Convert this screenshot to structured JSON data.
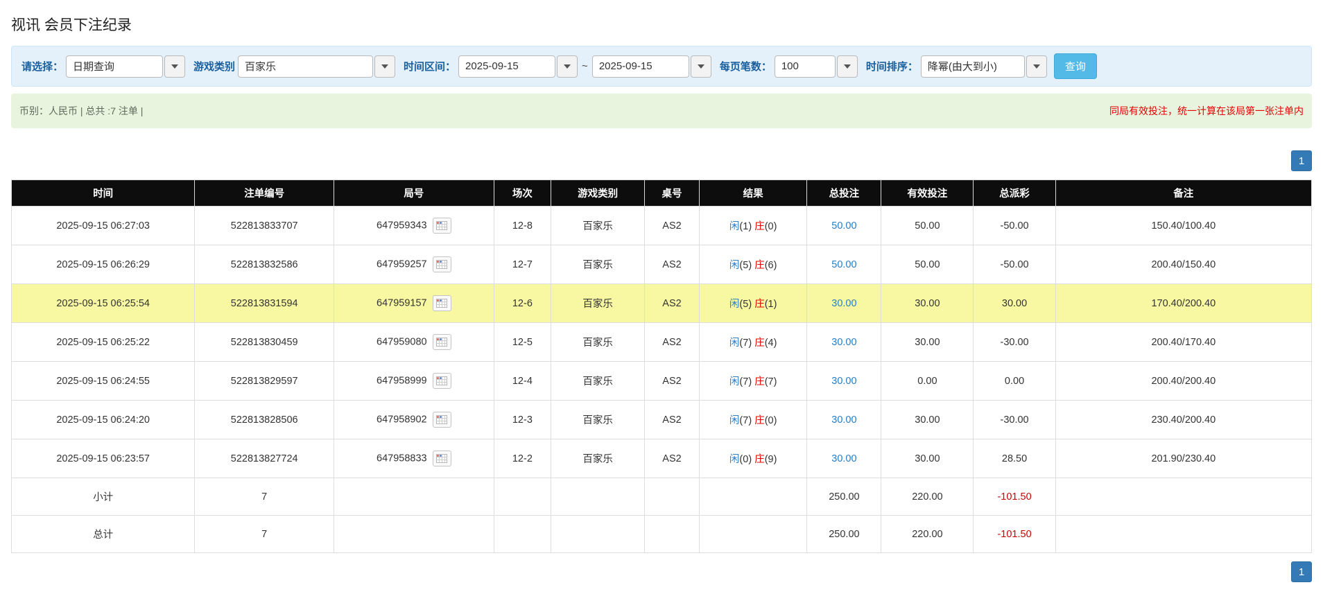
{
  "page": {
    "title": "视讯 会员下注纪录"
  },
  "filters": {
    "select_label": "请选择：",
    "select_value": "日期查询",
    "game_type_label": "游戏类别",
    "game_type_value": "百家乐",
    "date_range_label": "时间区间：",
    "date_from": "2025-09-15",
    "date_separator": "~",
    "date_to": "2025-09-15",
    "page_size_label": "每页笔数：",
    "page_size_value": "100",
    "sort_label": "时间排序：",
    "sort_value": "降幂(由大到小)",
    "search_button": "查询"
  },
  "summary": {
    "currency_info": "币别：人民币 | 总共 :7 注单 |",
    "notice": "同局有效投注，统一计算在该局第一张注单内"
  },
  "pagination": {
    "page": "1"
  },
  "table": {
    "headers": [
      "时间",
      "注单编号",
      "局号",
      "场次",
      "游戏类别",
      "桌号",
      "结果",
      "总投注",
      "有效投注",
      "总派彩",
      "备注"
    ],
    "rows": [
      {
        "time": "2025-09-15 06:27:03",
        "bet_id": "522813833707",
        "round_id": "647959343",
        "session": "12-8",
        "game": "百家乐",
        "table_no": "AS2",
        "player_label": "闲",
        "player_num": "(1)",
        "banker_label": "庄",
        "banker_num": "(0)",
        "total_bet": "50.00",
        "valid_bet": "50.00",
        "payout": "-50.00",
        "payout_red": true,
        "note": "150.40/100.40",
        "highlight": false
      },
      {
        "time": "2025-09-15 06:26:29",
        "bet_id": "522813832586",
        "round_id": "647959257",
        "session": "12-7",
        "game": "百家乐",
        "table_no": "AS2",
        "player_label": "闲",
        "player_num": "(5)",
        "banker_label": "庄",
        "banker_num": "(6)",
        "total_bet": "50.00",
        "valid_bet": "50.00",
        "payout": "-50.00",
        "payout_red": true,
        "note": "200.40/150.40",
        "highlight": false
      },
      {
        "time": "2025-09-15 06:25:54",
        "bet_id": "522813831594",
        "round_id": "647959157",
        "session": "12-6",
        "game": "百家乐",
        "table_no": "AS2",
        "player_label": "闲",
        "player_num": "(5)",
        "banker_label": "庄",
        "banker_num": "(1)",
        "total_bet": "30.00",
        "valid_bet": "30.00",
        "payout": "30.00",
        "payout_red": false,
        "note": "170.40/200.40",
        "highlight": true
      },
      {
        "time": "2025-09-15 06:25:22",
        "bet_id": "522813830459",
        "round_id": "647959080",
        "session": "12-5",
        "game": "百家乐",
        "table_no": "AS2",
        "player_label": "闲",
        "player_num": "(7)",
        "banker_label": "庄",
        "banker_num": "(4)",
        "total_bet": "30.00",
        "valid_bet": "30.00",
        "payout": "-30.00",
        "payout_red": true,
        "note": "200.40/170.40",
        "highlight": false
      },
      {
        "time": "2025-09-15 06:24:55",
        "bet_id": "522813829597",
        "round_id": "647958999",
        "session": "12-4",
        "game": "百家乐",
        "table_no": "AS2",
        "player_label": "闲",
        "player_num": "(7)",
        "banker_label": "庄",
        "banker_num": "(7)",
        "total_bet": "30.00",
        "valid_bet": "0.00",
        "payout": "0.00",
        "payout_red": false,
        "note": "200.40/200.40",
        "highlight": false
      },
      {
        "time": "2025-09-15 06:24:20",
        "bet_id": "522813828506",
        "round_id": "647958902",
        "session": "12-3",
        "game": "百家乐",
        "table_no": "AS2",
        "player_label": "闲",
        "player_num": "(7)",
        "banker_label": "庄",
        "banker_num": "(0)",
        "total_bet": "30.00",
        "valid_bet": "30.00",
        "payout": "-30.00",
        "payout_red": true,
        "note": "230.40/200.40",
        "highlight": false
      },
      {
        "time": "2025-09-15 06:23:57",
        "bet_id": "522813827724",
        "round_id": "647958833",
        "session": "12-2",
        "game": "百家乐",
        "table_no": "AS2",
        "player_label": "闲",
        "player_num": "(0)",
        "banker_label": "庄",
        "banker_num": "(9)",
        "total_bet": "30.00",
        "valid_bet": "30.00",
        "payout": "28.50",
        "payout_red": false,
        "note": "201.90/230.40",
        "highlight": false
      }
    ],
    "subtotal": {
      "label": "小计",
      "count": "7",
      "total_bet": "250.00",
      "valid_bet": "220.00",
      "payout": "-101.50"
    },
    "total": {
      "label": "总计",
      "count": "7",
      "total_bet": "250.00",
      "valid_bet": "220.00",
      "payout": "-101.50"
    }
  }
}
